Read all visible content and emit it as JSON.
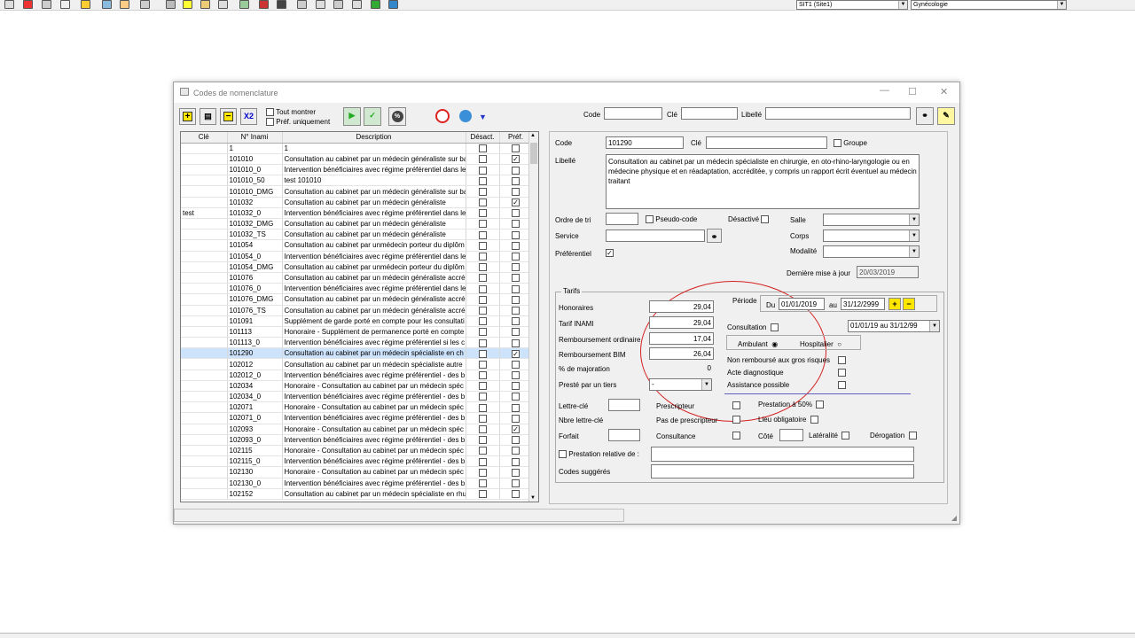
{
  "toolbar": {
    "site": "SIT1  (Site1)",
    "speciality": "Gynécologie"
  },
  "window": {
    "title": "Codes de nomenclature",
    "tout_montrer": "Tout montrer",
    "pref_uniquement": "Préf. uniquement",
    "x2": "X2"
  },
  "search": {
    "code_label": "Code",
    "cle_label": "Clé",
    "libelle_label": "Libellé"
  },
  "table": {
    "headers": [
      "Clé",
      "N° Inami",
      "Description",
      "Désact.",
      "Préf."
    ],
    "rows": [
      {
        "cle": "",
        "inami": "1",
        "desc": "1",
        "desact": false,
        "pref": false
      },
      {
        "cle": "",
        "inami": "101010",
        "desc": "Consultation au cabinet par un médecin généraliste sur ba",
        "desact": false,
        "pref": true
      },
      {
        "cle": "",
        "inami": "101010_0",
        "desc": "Intervention bénéficiaires avec régime préférentiel dans le",
        "desact": false,
        "pref": false
      },
      {
        "cle": "",
        "inami": "101010_50",
        "desc": "test 101010",
        "desact": false,
        "pref": false
      },
      {
        "cle": "",
        "inami": "101010_DMG",
        "desc": "Consultation au cabinet par un médecin généraliste sur ba",
        "desact": false,
        "pref": false
      },
      {
        "cle": "",
        "inami": "101032",
        "desc": "Consultation au cabinet par un médecin généraliste",
        "desact": false,
        "pref": true
      },
      {
        "cle": "test",
        "inami": "101032_0",
        "desc": "Intervention bénéficiaires avec régime préférentiel dans le",
        "desact": false,
        "pref": false
      },
      {
        "cle": "",
        "inami": "101032_DMG",
        "desc": "Consultation au cabinet par un médecin généraliste",
        "desact": false,
        "pref": false
      },
      {
        "cle": "",
        "inami": "101032_TS",
        "desc": "Consultation au cabinet par un médecin généraliste",
        "desact": false,
        "pref": false
      },
      {
        "cle": "",
        "inami": "101054",
        "desc": "Consultation au cabinet par unmédecin porteur du diplôm",
        "desact": false,
        "pref": false
      },
      {
        "cle": "",
        "inami": "101054_0",
        "desc": "Intervention bénéficiaires avec régime préférentiel dans le",
        "desact": false,
        "pref": false
      },
      {
        "cle": "",
        "inami": "101054_DMG",
        "desc": "Consultation au cabinet par unmédecin porteur du diplôm",
        "desact": false,
        "pref": false
      },
      {
        "cle": "",
        "inami": "101076",
        "desc": "Consultation au cabinet par un médecin généraliste accré",
        "desact": false,
        "pref": false
      },
      {
        "cle": "",
        "inami": "101076_0",
        "desc": "Intervention bénéficiaires avec régime préférentiel dans le",
        "desact": false,
        "pref": false
      },
      {
        "cle": "",
        "inami": "101076_DMG",
        "desc": "Consultation au cabinet par un médecin généraliste accré",
        "desact": false,
        "pref": false
      },
      {
        "cle": "",
        "inami": "101076_TS",
        "desc": "Consultation au cabinet par un médecin généraliste accré",
        "desact": false,
        "pref": false
      },
      {
        "cle": "",
        "inami": "101091",
        "desc": "Supplément de garde porté en compte pour les consultati",
        "desact": false,
        "pref": false
      },
      {
        "cle": "",
        "inami": "101113",
        "desc": "Honoraire - Supplément de permanence porté en compte",
        "desact": false,
        "pref": false
      },
      {
        "cle": "",
        "inami": "101113_0",
        "desc": "Intervention bénéficiaires avec régime préférentiel si les c",
        "desact": false,
        "pref": false
      },
      {
        "cle": "",
        "inami": "101290",
        "desc": "Consultation au cabinet par un médecin spécialiste en ch",
        "desact": false,
        "pref": true,
        "selected": true
      },
      {
        "cle": "",
        "inami": "102012",
        "desc": "Consultation au cabinet par un médecin spécialiste autre",
        "desact": false,
        "pref": false
      },
      {
        "cle": "",
        "inami": "102012_0",
        "desc": "Intervention bénéficiaires avec régime préférentiel - des b",
        "desact": false,
        "pref": false
      },
      {
        "cle": "",
        "inami": "102034",
        "desc": "Honoraire - Consultation au cabinet par un médecin spéc",
        "desact": false,
        "pref": false
      },
      {
        "cle": "",
        "inami": "102034_0",
        "desc": "Intervention bénéficiaires avec régime préférentiel - des b",
        "desact": false,
        "pref": false
      },
      {
        "cle": "",
        "inami": "102071",
        "desc": "Honoraire - Consultation au cabinet par un médecin spéc",
        "desact": false,
        "pref": false
      },
      {
        "cle": "",
        "inami": "102071_0",
        "desc": "Intervention bénéficiaires avec régime préférentiel - des b",
        "desact": false,
        "pref": false
      },
      {
        "cle": "",
        "inami": "102093",
        "desc": "Honoraire - Consultation au cabinet par un médecin spéc",
        "desact": false,
        "pref": true
      },
      {
        "cle": "",
        "inami": "102093_0",
        "desc": "Intervention bénéficiaires avec régime préférentiel - des b",
        "desact": false,
        "pref": false
      },
      {
        "cle": "",
        "inami": "102115",
        "desc": "Honoraire - Consultation au cabinet par un médecin spéc",
        "desact": false,
        "pref": false
      },
      {
        "cle": "",
        "inami": "102115_0",
        "desc": "Intervention bénéficiaires avec régime préférentiel - des b",
        "desact": false,
        "pref": false
      },
      {
        "cle": "",
        "inami": "102130",
        "desc": "Honoraire - Consultation au cabinet par un médecin spéc",
        "desact": false,
        "pref": false
      },
      {
        "cle": "",
        "inami": "102130_0",
        "desc": "Intervention bénéficiaires avec régime préférentiel - des b",
        "desact": false,
        "pref": false
      },
      {
        "cle": "",
        "inami": "102152",
        "desc": "Consultation au cabinet par un médecin spécialiste en rhu",
        "desact": false,
        "pref": false
      }
    ]
  },
  "detail": {
    "code_label": "Code",
    "code": "101290",
    "cle_label": "Clé",
    "groupe_label": "Groupe",
    "libelle_label": "Libellé",
    "libelle": "Consultation au cabinet par un médecin spécialiste en chirurgie, en oto-rhino-laryngologie ou en médecine physique et en réadaptation, accréditée, y compris un rapport écrit éventuel au médecin traitant",
    "ordre_label": "Ordre de tri",
    "pseudo_label": "Pseudo-code",
    "desactive_label": "Désactivé",
    "salle_label": "Salle",
    "service_label": "Service",
    "corps_label": "Corps",
    "preferentiel_label": "Préférentiel",
    "modalite_label": "Modalité",
    "maj_label": "Dernière mise à jour",
    "maj": "20/03/2019"
  },
  "tarifs": {
    "legend": "Tarifs",
    "honoraires_label": "Honoraires",
    "honoraires": "29,04",
    "inami_label": "Tarif INAMI",
    "inami": "29,04",
    "remb_label": "Remboursement ordinaire",
    "remb": "17,04",
    "bim_label": "Remboursement BIM",
    "bim": "26,04",
    "majoration_label": "% de majoration",
    "majoration": "0",
    "tiers_label": "Presté par un tiers",
    "tiers": "-",
    "periode_label": "Période",
    "du_label": "Du",
    "du": "01/01/2019",
    "au_label": "au",
    "au": "31/12/2999",
    "consultation_label": "Consultation",
    "periode_select": "01/01/19 au 31/12/99",
    "ambulant_label": "Ambulant",
    "hospitalier_label": "Hospitalier",
    "gros_risques_label": "Non remboursé aux gros risques",
    "acte_diag_label": "Acte diagnostique",
    "assistance_label": "Assistance possible",
    "lettre_cle_label": "Lettre-clé",
    "prescripteur_label": "Prescripteur",
    "prestation50_label": "Prestation à 50%",
    "nbre_lettre_label": "Nbre lettre-clé",
    "pas_prescripteur_label": "Pas de prescripteur",
    "lieu_label": "Lieu obligatoire",
    "forfait_label": "Forfait",
    "consultance_label": "Consultance",
    "cote_label": "Côté",
    "lateralite_label": "Latéralité",
    "derogation_label": "Dérogation",
    "prestation_relative_label": "Prestation relative de :",
    "codes_suggeres_label": "Codes suggérés"
  }
}
